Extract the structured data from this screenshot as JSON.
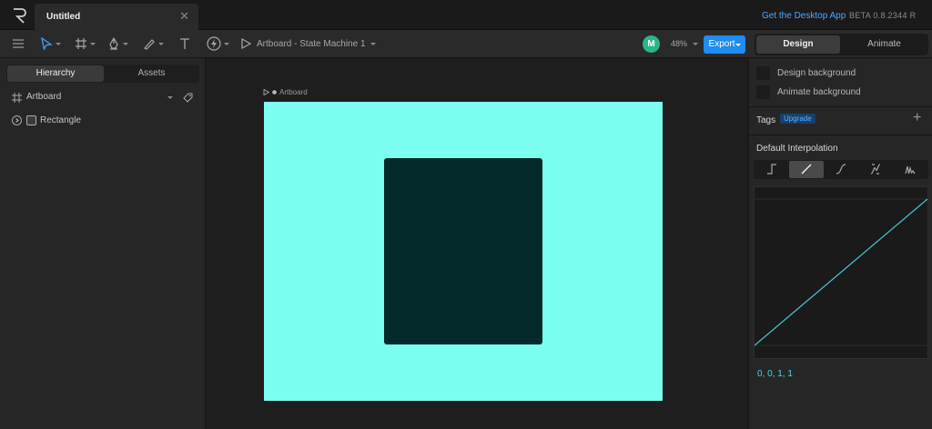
{
  "app": {
    "document_tab": "Untitled",
    "desktop_link": "Get the Desktop App",
    "version": "BETA 0.8.2344 R"
  },
  "toolbar": {
    "breadcrumb": "Artboard - State Machine 1",
    "avatar_initial": "M",
    "zoom": "48%",
    "export_label": "Export",
    "modes": [
      "Design",
      "Animate"
    ],
    "active_mode": "Design",
    "accent_color": "#1e8cf0"
  },
  "left_panel": {
    "tabs": [
      "Hierarchy",
      "Assets"
    ],
    "active_tab": "Hierarchy",
    "tree": [
      {
        "label": "Artboard",
        "icon": "artboard-icon"
      },
      {
        "label": "Rectangle",
        "icon": "shape-icon"
      }
    ]
  },
  "canvas": {
    "artboard_label": "Artboard",
    "artboard_color": "#7cfef0",
    "rectangle_color": "#04292a"
  },
  "right_panel": {
    "checkboxes": [
      "Design background",
      "Animate background"
    ],
    "tags_label": "Tags",
    "upgrade_badge": "Upgrade",
    "interpolation_title": "Default Interpolation",
    "interpolation_options": [
      "hold",
      "linear",
      "cubic",
      "cubic-mirror",
      "elastic"
    ],
    "selected_interpolation": "linear",
    "curve_values": "0, 0, 1, 1"
  }
}
